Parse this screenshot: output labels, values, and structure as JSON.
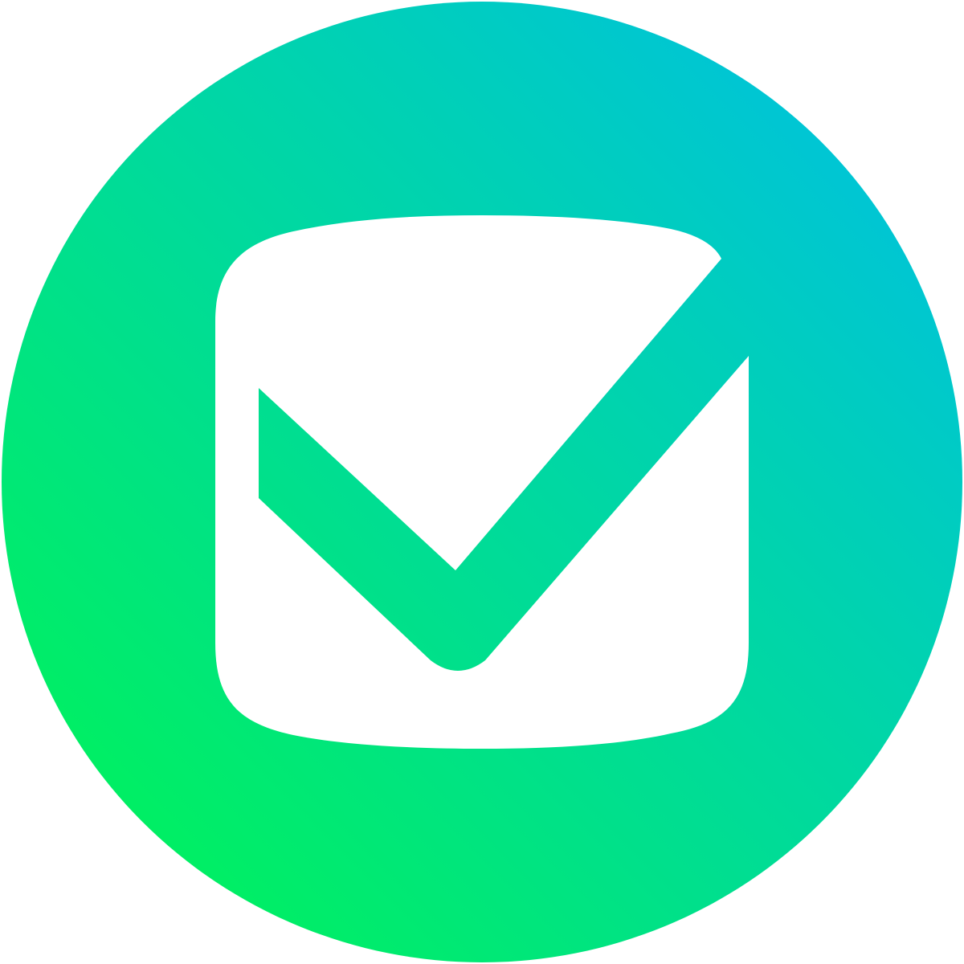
{
  "logo": {
    "icon": "checkbox-check-icon",
    "colors": {
      "gradient_start": "#00F060",
      "gradient_end": "#00C4D8",
      "glyph": "#FFFFFF"
    }
  }
}
